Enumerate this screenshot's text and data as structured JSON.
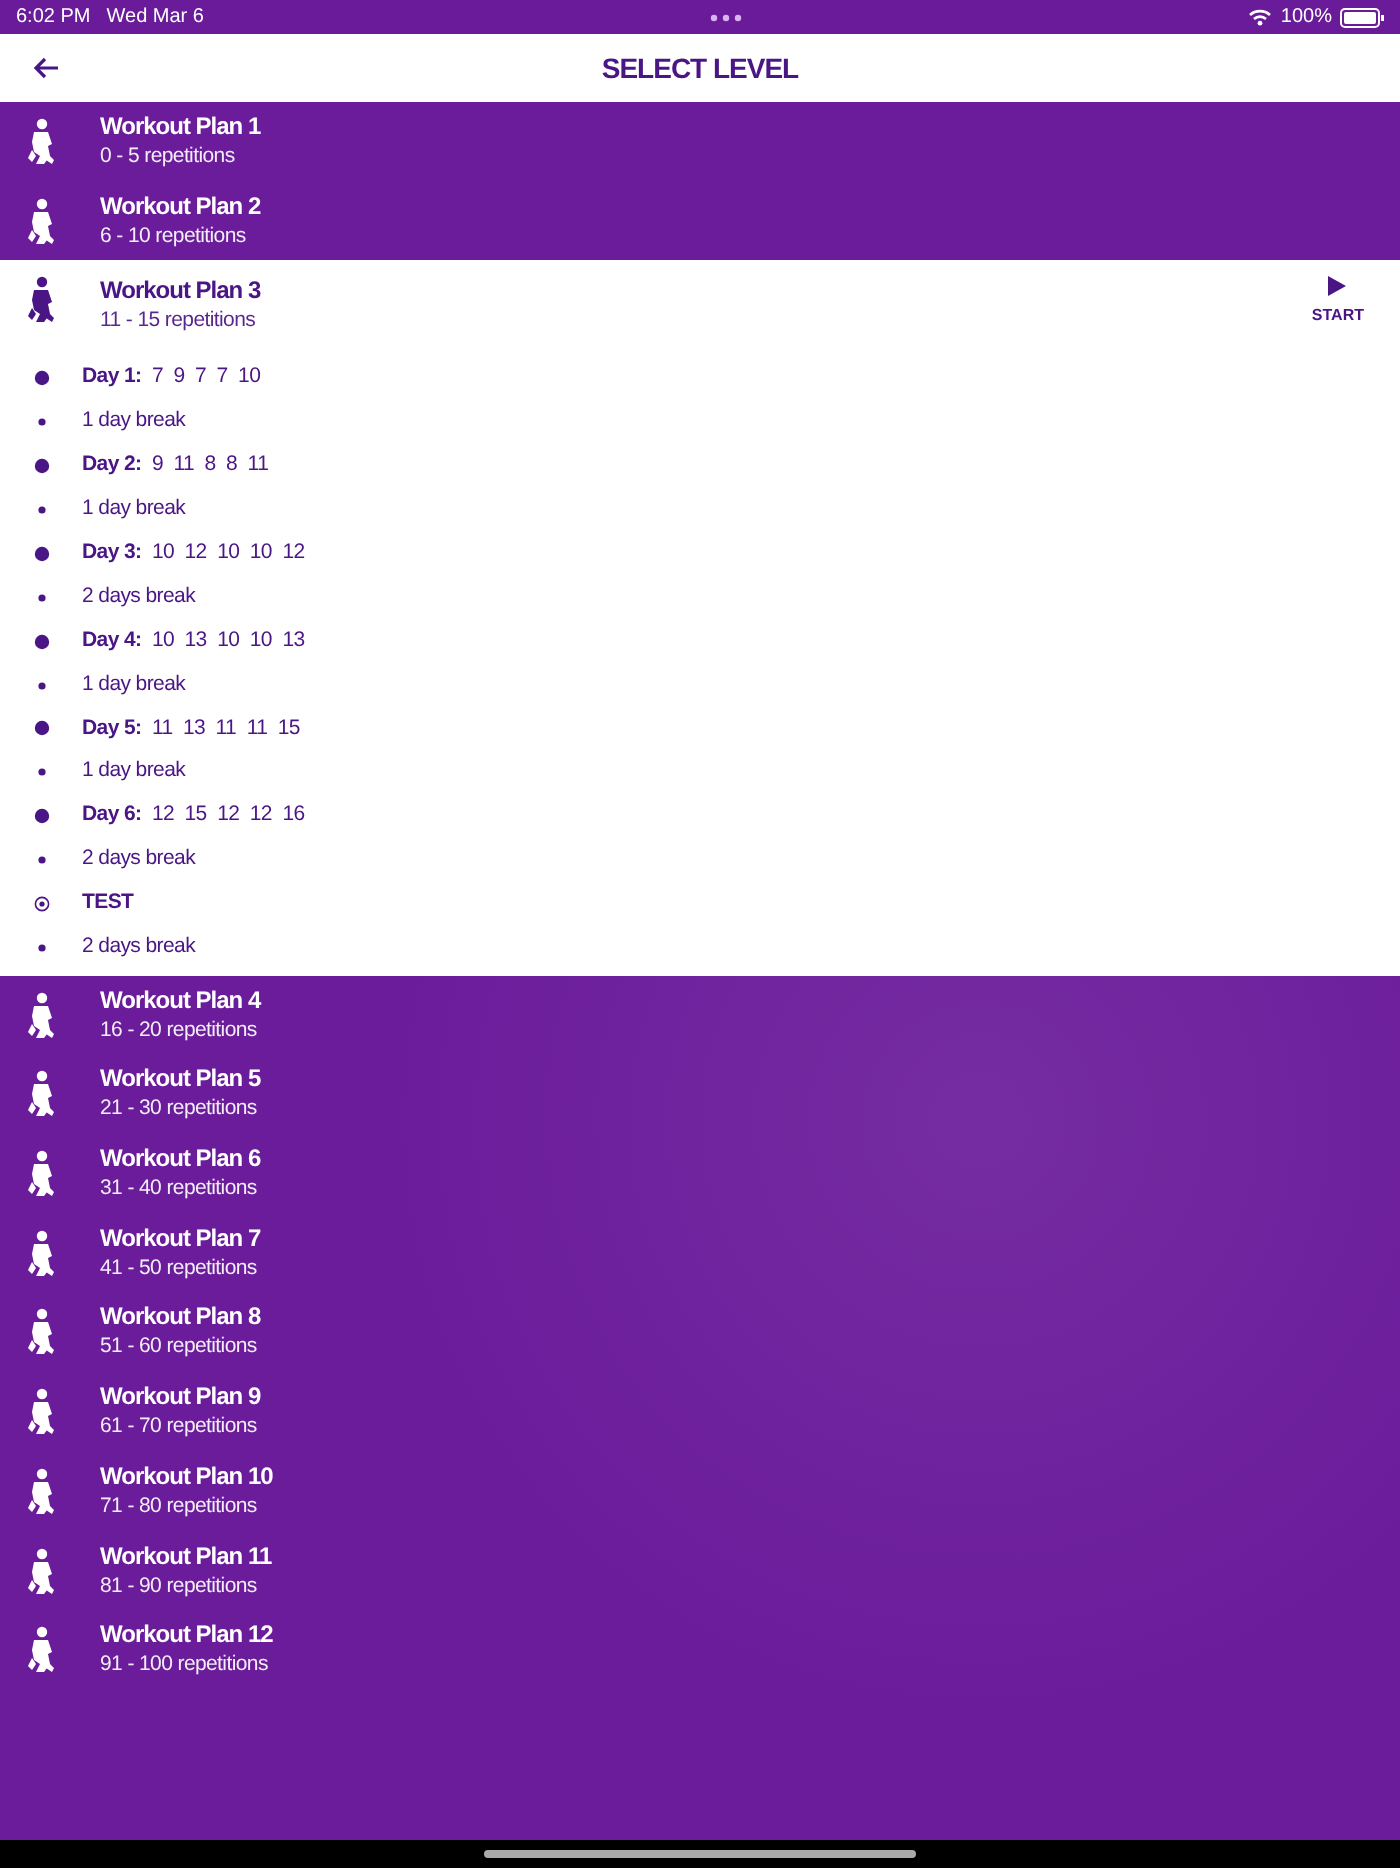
{
  "status_bar": {
    "time": "6:02 PM",
    "date": "Wed Mar 6",
    "battery": "100%"
  },
  "header": {
    "title": "SELECT LEVEL"
  },
  "plans": [
    {
      "title": "Workout Plan 1",
      "reps": "0 - 5 repetitions",
      "expanded": false
    },
    {
      "title": "Workout Plan 2",
      "reps": "6 - 10 repetitions",
      "expanded": false
    },
    {
      "title": "Workout Plan 3",
      "reps": "11 - 15 repetitions",
      "expanded": true,
      "start": "START",
      "schedule": [
        {
          "kind": "day",
          "label": "Day 1:",
          "reps": "7  9  7  7  10"
        },
        {
          "kind": "break",
          "label": "1 day break"
        },
        {
          "kind": "day",
          "label": "Day 2:",
          "reps": "9  11  8  8  11"
        },
        {
          "kind": "break",
          "label": "1 day break"
        },
        {
          "kind": "day",
          "label": "Day 3:",
          "reps": "10  12  10  10  12"
        },
        {
          "kind": "break",
          "label": "2 days break"
        },
        {
          "kind": "day",
          "label": "Day 4:",
          "reps": "10  13  10  10  13"
        },
        {
          "kind": "break",
          "label": "1 day break"
        },
        {
          "kind": "day",
          "label": "Day 5:",
          "reps": "11  13  11  11  15"
        },
        {
          "kind": "break",
          "label": "1 day break"
        },
        {
          "kind": "day",
          "label": "Day 6:",
          "reps": "12  15  12  12  16"
        },
        {
          "kind": "break",
          "label": "2 days break"
        },
        {
          "kind": "test",
          "label": "TEST"
        },
        {
          "kind": "break",
          "label": "2 days break"
        }
      ]
    },
    {
      "title": "Workout Plan 4",
      "reps": "16 - 20 repetitions",
      "expanded": false
    },
    {
      "title": "Workout Plan 5",
      "reps": "21 - 30 repetitions",
      "expanded": false
    },
    {
      "title": "Workout Plan 6",
      "reps": "31 - 40 repetitions",
      "expanded": false
    },
    {
      "title": "Workout Plan 7",
      "reps": "41 - 50 repetitions",
      "expanded": false
    },
    {
      "title": "Workout Plan 8",
      "reps": "51 - 60 repetitions",
      "expanded": false
    },
    {
      "title": "Workout Plan 9",
      "reps": "61 - 70 repetitions",
      "expanded": false
    },
    {
      "title": "Workout Plan 10",
      "reps": "71 - 80 repetitions",
      "expanded": false
    },
    {
      "title": "Workout Plan 11",
      "reps": "81 - 90 repetitions",
      "expanded": false
    },
    {
      "title": "Workout Plan 12",
      "reps": "91 - 100 repetitions",
      "expanded": false
    }
  ]
}
